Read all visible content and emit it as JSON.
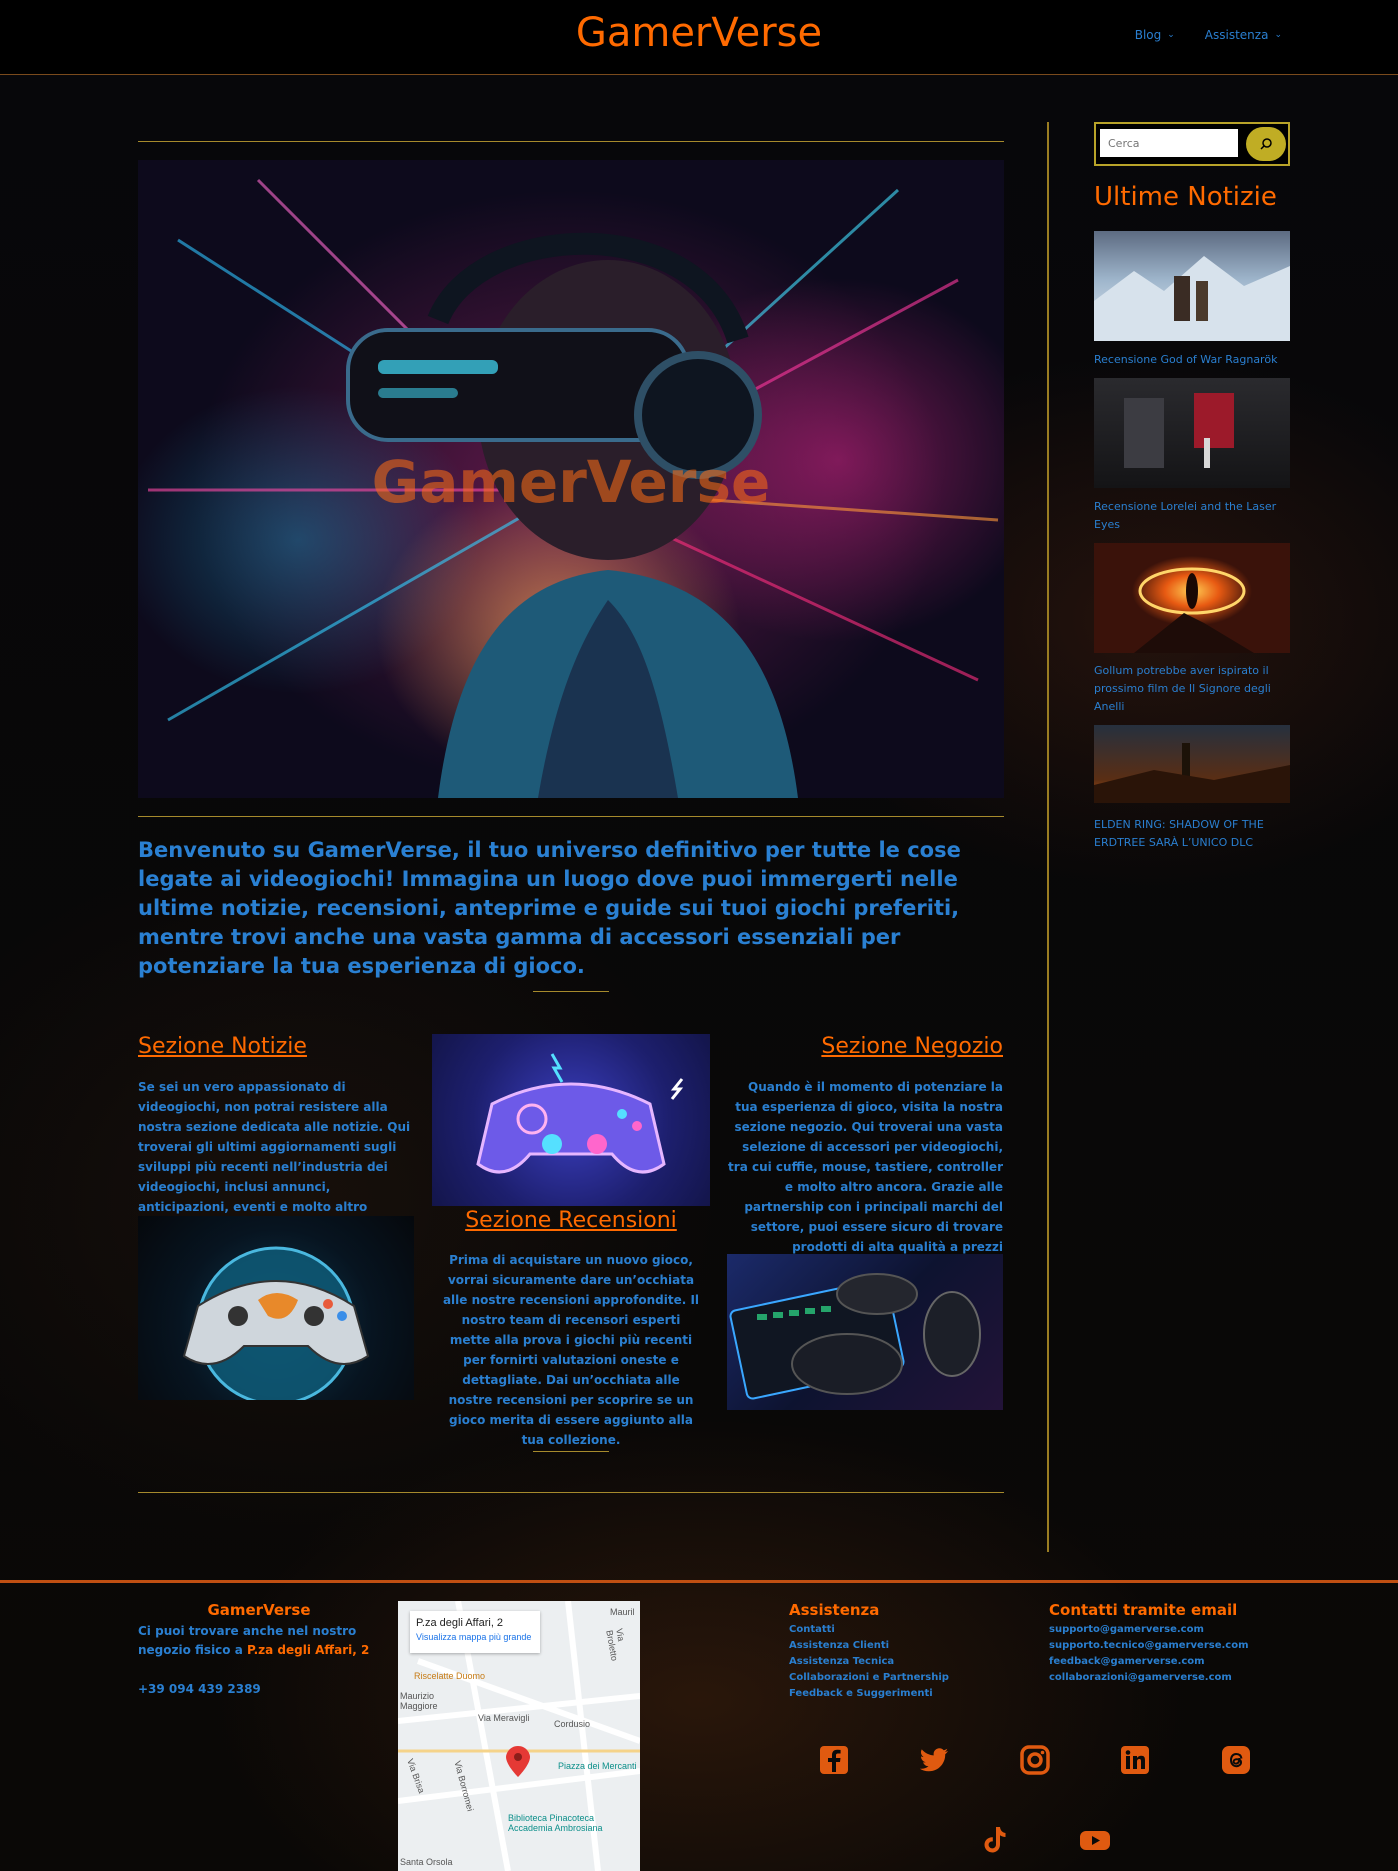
{
  "header": {
    "site_title": "GamerVerse",
    "nav": [
      {
        "label": "Blog"
      },
      {
        "label": "Assistenza"
      }
    ]
  },
  "hero": {
    "caption": "GamerVerse"
  },
  "intro": {
    "text": "Benvenuto su GamerVerse, il tuo universo definitivo per tutte le cose legate ai videogiochi! Immagina un luogo dove puoi immergerti nelle ultime notizie, recensioni, anteprime e guide sui tuoi giochi preferiti, mentre trovi anche una vasta gamma di accessori essenziali per potenziare la tua esperienza di gioco."
  },
  "sections": {
    "news": {
      "title": "Sezione Notizie",
      "text": "Se sei un vero appassionato di videogiochi, non potrai resistere alla nostra sezione dedicata alle notizie. Qui troverai gli ultimi aggiornamenti sugli sviluppi più recenti nell’industria dei videogiochi, inclusi annunci, anticipazioni, eventi e molto altro ancora."
    },
    "reviews": {
      "title": "Sezione Recensioni",
      "text": "Prima di acquistare un nuovo gioco, vorrai sicuramente dare un’occhiata alle nostre recensioni approfondite. Il nostro team di recensori esperti mette alla prova i giochi più recenti per fornirti valutazioni oneste e dettagliate. Dai un’occhiata alle nostre recensioni per scoprire se un gioco merita di essere aggiunto alla tua collezione."
    },
    "shop": {
      "title": "Sezione Negozio",
      "text": "Quando è il momento di potenziare la tua esperienza di gioco, visita la nostra sezione negozio. Qui troverai una vasta selezione di accessori per videogiochi, tra cui cuffie, mouse, tastiere, controller e molto altro ancora. Grazie alle partnership con i principali marchi del settore, puoi essere sicuro di trovare prodotti di alta qualità a prezzi competitivi."
    }
  },
  "sidebar": {
    "search_placeholder": "Cerca",
    "heading": "Ultime Notizie",
    "items": [
      {
        "label": "Recensione God of War Ragnarök"
      },
      {
        "label": "Recensione Lorelei and the Laser Eyes"
      },
      {
        "label": "Gollum potrebbe aver ispirato il prossimo film de Il Signore degli Anelli"
      },
      {
        "label": "ELDEN RING: SHADOW OF THE ERDTREE SARÀ L’UNICO DLC"
      }
    ]
  },
  "footer": {
    "brand": {
      "title": "GamerVerse",
      "text_prefix": "Ci puoi trovare anche nel nostro negozio fisico a ",
      "address": "P.za degli Affari, 2",
      "phone": "+39 094 439 2389"
    },
    "map": {
      "place": "P.za degli Affari, 2",
      "link": "Visualizza mappa più grande",
      "labels": [
        "Riscelatte Duomo",
        "Maurizio Maggiore",
        "Via Meravigli",
        "Cordusio",
        "Piazza dei Mercanti",
        "Biblioteca Pinacoteca Accademia Ambrosiana",
        "Via Broletto",
        "Via Borromei",
        "Via Brisa",
        "Santa Orsola",
        "Mauril"
      ]
    },
    "assistance": {
      "title": "Assistenza",
      "items": [
        "Contatti",
        "Assistenza Clienti",
        "Assistenza Tecnica",
        "Collaborazioni e Partnership",
        "Feedback e Suggerimenti"
      ]
    },
    "emails": {
      "title": "Contatti tramite email",
      "items": [
        "supporto@gamerverse.com",
        "supporto.tecnico@gamerverse.com",
        "feedback@gamerverse.com",
        "collaborazioni@gamerverse.com"
      ]
    },
    "social": [
      "facebook-icon",
      "twitter-icon",
      "instagram-icon",
      "linkedin-icon",
      "threads-icon",
      "tiktok-icon",
      "youtube-icon"
    ]
  },
  "colors": {
    "accent": "#ff6a00",
    "text_blue": "#2a7fd0",
    "gold": "#a68a2c",
    "background": "#050507"
  }
}
